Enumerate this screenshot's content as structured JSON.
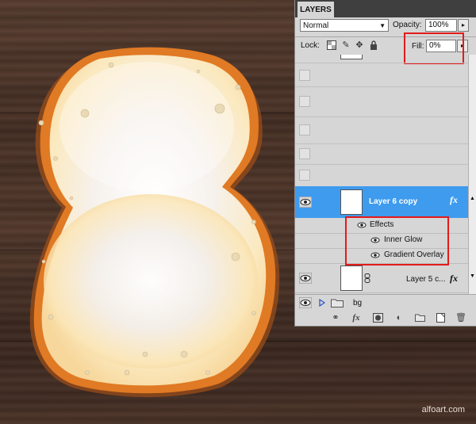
{
  "panel": {
    "tab_label": "LAYERS",
    "blend_mode": "Normal",
    "opacity_label": "Opacity:",
    "opacity_value": "100%",
    "lock_label": "Lock:",
    "fill_label": "Fill:",
    "fill_value": "0%",
    "selected_layer": {
      "name": "Layer 6 copy",
      "fx_label": "fx"
    },
    "effects": {
      "header": "Effects",
      "items": [
        "Inner Glow",
        "Gradient Overlay"
      ]
    },
    "layer_below": {
      "name": "Layer 5 c...",
      "fx_label": "fx"
    },
    "group_name": "bg"
  },
  "watermark": "alfoart.com",
  "colors": {
    "selection": "#3e9bee",
    "highlight_box": "#e21b1b",
    "blob_glow": "#fbe7b0",
    "blob_rim": "#e07a24"
  },
  "icons": [
    "lock-transparency-icon",
    "brush-icon",
    "move-icon",
    "lock-icon",
    "eye-icon",
    "chain-link-icon",
    "folder-icon",
    "triangle-expand-icon",
    "fx-icon",
    "mask-icon",
    "adjustment-icon",
    "new-group-icon",
    "new-layer-icon",
    "trash-icon"
  ]
}
